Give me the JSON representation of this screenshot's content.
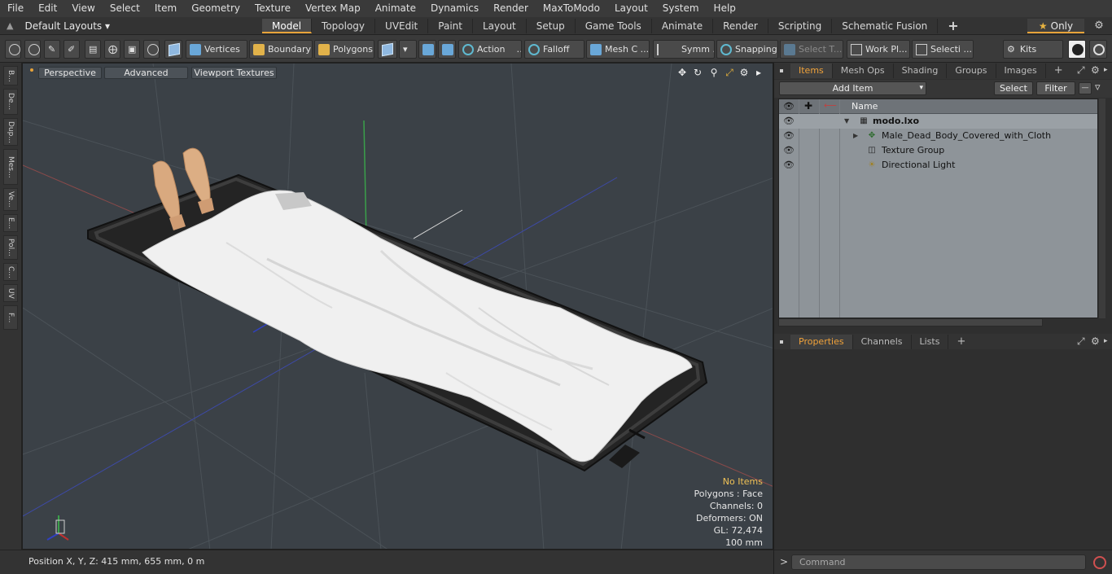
{
  "menu": [
    "File",
    "Edit",
    "View",
    "Select",
    "Item",
    "Geometry",
    "Texture",
    "Vertex Map",
    "Animate",
    "Dynamics",
    "Render",
    "MaxToModo",
    "Layout",
    "System",
    "Help"
  ],
  "layout": {
    "label": "Default Layouts ▾"
  },
  "mode_tabs": [
    "Model",
    "Topology",
    "UVEdit",
    "Paint",
    "Layout",
    "Setup",
    "Game Tools",
    "Animate",
    "Render",
    "Scripting",
    "Schematic Fusion"
  ],
  "only_label": "Only",
  "toolbar": {
    "vertices": "Vertices",
    "boundary": "Boundary",
    "polygons": "Polygons",
    "action": "Action",
    "falloff": "Falloff",
    "mesh": "Mesh C ...",
    "symm": "Symm ...",
    "snapping": "Snapping",
    "select_t": "Select T...",
    "work_pl": "Work Pl...",
    "selecti": "Selecti ...",
    "kits": "Kits"
  },
  "left_tabs": [
    "B...",
    "De...",
    "Dup...",
    "Mes...",
    "Ve...",
    "E...",
    "Pol...",
    "C...",
    "UV",
    "F..."
  ],
  "viewport": {
    "perspective": "Perspective",
    "advanced": "Advanced",
    "textures": "Viewport Textures",
    "stats": {
      "no_items": "No Items",
      "polygons": "Polygons : Face",
      "channels": "Channels: 0",
      "deformers": "Deformers: ON",
      "gl": "GL: 72,474",
      "scale": "100 mm"
    }
  },
  "status": {
    "position": "Position X, Y, Z:   415 mm, 655 mm, 0 m"
  },
  "panel_tabs": [
    "Items",
    "Mesh Ops",
    "Shading",
    "Groups",
    "Images"
  ],
  "items_toolbar": {
    "add_item": "Add Item",
    "select": "Select",
    "filter": "Filter"
  },
  "item_list": {
    "col_name": "Name",
    "rows": [
      {
        "label": "modo.lxo",
        "icon": "scene-icon"
      },
      {
        "label": "Male_Dead_Body_Covered_with_Cloth",
        "icon": "mesh-icon"
      },
      {
        "label": "Texture Group",
        "icon": "texture-group-icon"
      },
      {
        "label": "Directional Light",
        "icon": "light-icon"
      }
    ]
  },
  "props_tabs": [
    "Properties",
    "Channels",
    "Lists"
  ],
  "command": {
    "placeholder": "Command"
  }
}
